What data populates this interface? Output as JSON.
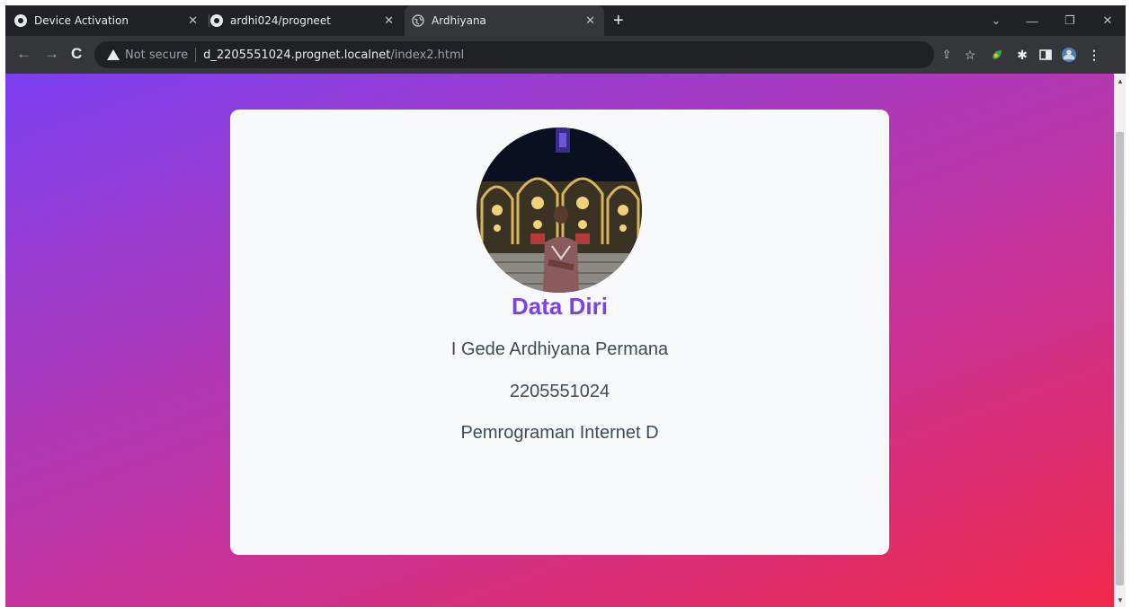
{
  "browser": {
    "tabs": [
      {
        "title": "Device Activation",
        "icon": "github-icon",
        "active": false
      },
      {
        "title": "ardhi024/progneet",
        "icon": "github-icon",
        "active": false
      },
      {
        "title": "Ardhiyana",
        "icon": "globe-icon",
        "active": true
      }
    ],
    "address": {
      "security_label": "Not secure",
      "host": "d_2205551024.prognet.localnet",
      "path": "/index2.html"
    }
  },
  "card": {
    "title": "Data Diri",
    "name": "I Gede Ardhiyana Permana",
    "nim": "2205551024",
    "course": "Pemrograman Internet D"
  },
  "colors": {
    "title": "#7a42e8",
    "text": "#3d4a59",
    "gradient_start": "#7b3ff2",
    "gradient_end": "#f0294b"
  }
}
